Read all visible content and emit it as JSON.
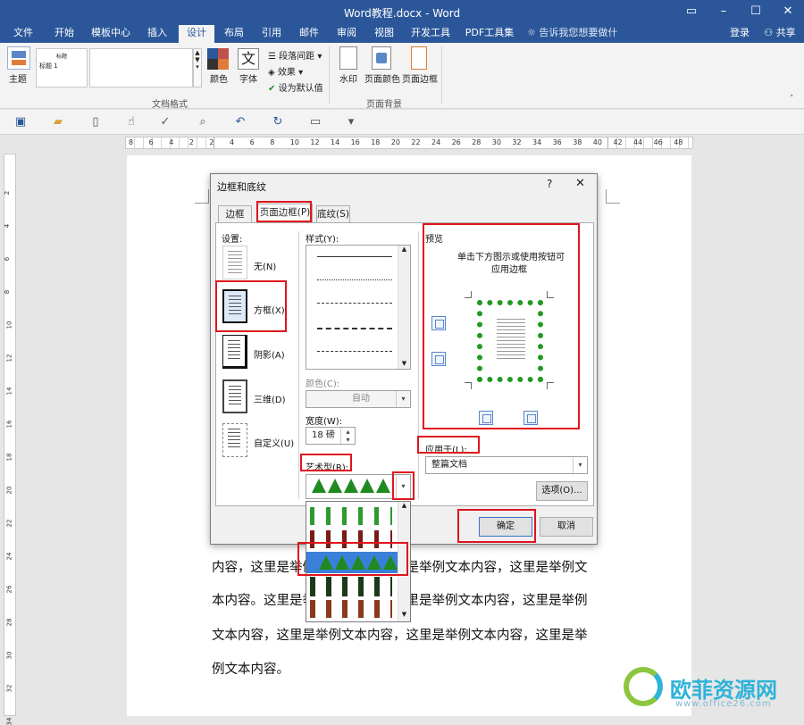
{
  "window": {
    "title": "Word教程.docx - Word",
    "signin": "登录",
    "share": "共享",
    "tellme": "告诉我您想要做什么..."
  },
  "tabs": [
    "文件",
    "开始",
    "模板中心",
    "插入",
    "设计",
    "布局",
    "引用",
    "邮件",
    "审阅",
    "视图",
    "开发工具",
    "PDF工具集"
  ],
  "active_tab": "设计",
  "ribbon": {
    "theme_label": "主题",
    "style_title": "标题",
    "style_heading": "标题 1",
    "colors_label": "颜色",
    "font_label": "字体",
    "paragraph_spacing": "段落间距",
    "effects": "效果",
    "set_default": "设为默认值",
    "doc_format_group": "文档格式",
    "watermark": "水印",
    "page_color": "页面颜色",
    "page_border": "页面边框",
    "page_bg_group": "页面背景"
  },
  "ruler_h": [
    "8",
    "6",
    "4",
    "2",
    "2",
    "4",
    "6",
    "8",
    "10",
    "12",
    "14",
    "16",
    "18",
    "20",
    "22",
    "24",
    "26",
    "28",
    "30",
    "32",
    "34",
    "36",
    "38",
    "40",
    "42",
    "44",
    "46",
    "48"
  ],
  "ruler_v": [
    "2",
    "4",
    "6",
    "8",
    "10",
    "12",
    "14",
    "16",
    "18",
    "20",
    "22",
    "24",
    "26",
    "28",
    "30",
    "32",
    "34"
  ],
  "document": {
    "lines": [
      "内容，这里是举例文本内容，这里是举例文本内容，这里是举例文",
      "本内容。这里是举例文本内容，这里是举例文本内容，这里是举例",
      "文本内容，这里是举例文本内容，这里是举例文本内容，这里是举",
      "例文本内容。"
    ]
  },
  "dialog": {
    "title": "边框和底纹",
    "help": "?",
    "close": "✕",
    "tabs": [
      "边框(B)",
      "页面边框(P)",
      "底纹(S)"
    ],
    "active_tab": "页面边框(P)",
    "settings_label": "设置:",
    "settings": [
      "无(N)",
      "方框(X)",
      "阴影(A)",
      "三维(D)",
      "自定义(U)"
    ],
    "selected_setting": "方框(X)",
    "style_label": "样式(Y):",
    "color_label": "颜色(C):",
    "color_value": "自动",
    "width_label": "宽度(W):",
    "width_value": "18 磅",
    "art_label": "艺术型(R):",
    "preview_label": "预览",
    "preview_hint_1": "单击下方图示或使用按钮可",
    "preview_hint_2": "应用边框",
    "apply_label": "应用于(L):",
    "apply_value": "整篇文档",
    "options_button": "选项(O)...",
    "ok_button": "确定",
    "cancel_button": "取消"
  },
  "watermark": {
    "text": "欧菲资源网",
    "url": "www.office26.com"
  },
  "colors": {
    "word_blue": "#2b579a",
    "highlight_red": "#e0141e",
    "tree_green": "#1f8a1f"
  }
}
